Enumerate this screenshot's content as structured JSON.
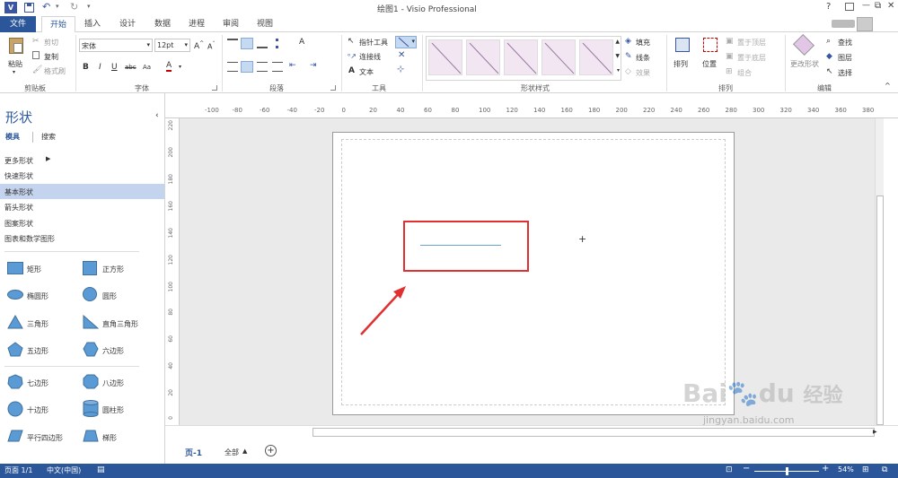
{
  "title": "绘图1 - Visio Professional",
  "window_controls": {
    "help": "?",
    "minimize": "—",
    "restore": "⧉",
    "close": "✕"
  },
  "tabs": [
    {
      "label": "文件"
    },
    {
      "label": "开始"
    },
    {
      "label": "插入"
    },
    {
      "label": "设计"
    },
    {
      "label": "数据"
    },
    {
      "label": "进程"
    },
    {
      "label": "审阅"
    },
    {
      "label": "视图"
    }
  ],
  "ribbon": {
    "clipboard": {
      "paste": "粘贴",
      "cut": "剪切",
      "copy": "复制",
      "format_painter": "格式刷",
      "label": "剪贴板"
    },
    "font": {
      "font_name": "宋体",
      "font_size": "12pt",
      "label": "字体"
    },
    "paragraph": {
      "label": "段落"
    },
    "tools": {
      "pointer": "指针工具",
      "connector": "连接线",
      "text": "文本",
      "label": "工具"
    },
    "shape_styles": {
      "label": "形状样式",
      "fill": "填充",
      "line": "线条",
      "effects": "效果"
    },
    "arrange": {
      "arrange": "排列",
      "position": "位置",
      "bring_front": "置于顶层",
      "send_back": "置于底层",
      "group": "组合",
      "label": "排列"
    },
    "editing": {
      "change_shape": "更改形状",
      "find": "查找",
      "layers": "图层",
      "select": "选择",
      "label": "编辑"
    }
  },
  "shapes_pane": {
    "title": "形状",
    "tab_stencils": "模具",
    "tab_search": "搜索",
    "categories": [
      "更多形状",
      "快速形状",
      "基本形状",
      "箭头形状",
      "图案形状",
      "图表和数学图形"
    ],
    "shapes": [
      "矩形",
      "正方形",
      "椭圆形",
      "圆形",
      "三角形",
      "直角三角形",
      "五边形",
      "六边形",
      "七边形",
      "八边形",
      "十边形",
      "圆柱形",
      "平行四边形",
      "梯形"
    ]
  },
  "ruler": {
    "h_ticks": [
      "-100",
      "-80",
      "-60",
      "-40",
      "-20",
      "0",
      "20",
      "40",
      "60",
      "80",
      "100",
      "120",
      "140",
      "160",
      "180",
      "200",
      "220",
      "240",
      "260",
      "280",
      "300",
      "320",
      "340",
      "360",
      "380"
    ],
    "v_ticks": [
      "220",
      "200",
      "180",
      "160",
      "140",
      "120",
      "100",
      "80",
      "60",
      "40",
      "20",
      "0"
    ]
  },
  "page_tabs": {
    "page1": "页-1",
    "all": "全部"
  },
  "watermark": {
    "brand": "Bai",
    "brand2": "du",
    "product": "经验",
    "url": "jingyan.baidu.com"
  },
  "status": {
    "page": "页面 1/1",
    "language": "中文(中国)",
    "zoom": "54%"
  }
}
